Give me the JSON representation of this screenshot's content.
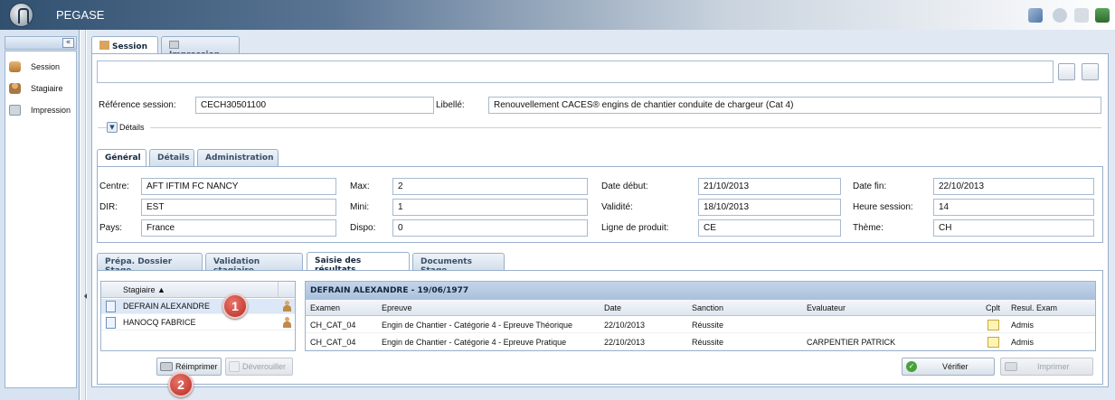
{
  "app": {
    "title": "PEGASE"
  },
  "sidebar": {
    "collapse_label": "«",
    "items": [
      {
        "label": "Session"
      },
      {
        "label": "Stagiaire"
      },
      {
        "label": "Impression"
      }
    ]
  },
  "main_tabs": [
    {
      "label": "Session",
      "active": true
    },
    {
      "label": "Impression",
      "active": false
    }
  ],
  "session": {
    "search_value": "",
    "reference_label": "Référence session:",
    "reference_value": "CECH30501100",
    "libelle_label": "Libellé:",
    "libelle_value": "Renouvellement CACES® engins de chantier conduite de chargeur (Cat 4)",
    "details_toggle": "Détails"
  },
  "detail_tabs": [
    {
      "label": "Général",
      "active": true
    },
    {
      "label": "Détails",
      "active": false
    },
    {
      "label": "Administration",
      "active": false
    }
  ],
  "general": {
    "centre_label": "Centre:",
    "centre_value": "AFT IFTIM FC NANCY",
    "dir_label": "DIR:",
    "dir_value": "EST",
    "pays_label": "Pays:",
    "pays_value": "France",
    "max_label": "Max:",
    "max_value": "2",
    "mini_label": "Mini:",
    "mini_value": "1",
    "dispo_label": "Dispo:",
    "dispo_value": "0",
    "date_debut_label": "Date début:",
    "date_debut_value": "21/10/2013",
    "validite_label": "Validité:",
    "validite_value": "18/10/2013",
    "ligne_label": "Ligne de produit:",
    "ligne_value": "CE",
    "date_fin_label": "Date fin:",
    "date_fin_value": "22/10/2013",
    "heure_label": "Heure session:",
    "heure_value": "14",
    "theme_label": "Thème:",
    "theme_value": "CH"
  },
  "stage_tabs": [
    {
      "label": "Prépa. Dossier Stage",
      "active": false
    },
    {
      "label": "Validation stagiaire",
      "active": false
    },
    {
      "label": "Saisie des résultats",
      "active": true
    },
    {
      "label": "Documents Stage",
      "active": false
    }
  ],
  "stagiaire_grid": {
    "header": "Stagiaire ▲",
    "rows": [
      {
        "name": "DEFRAIN ALEXANDRE"
      },
      {
        "name": "HANOCQ FABRICE"
      }
    ]
  },
  "results": {
    "title": "DEFRAIN ALEXANDRE - 19/06/1977",
    "columns": [
      "Examen",
      "Epreuve",
      "Date",
      "Sanction",
      "Evaluateur",
      "Cplt",
      "Resul. Exam"
    ],
    "rows": [
      {
        "examen": "CH_CAT_04",
        "epreuve": "Engin de Chantier - Catégorie 4 - Epreuve Théorique",
        "date": "22/10/2013",
        "sanction": "Réussite",
        "evaluateur": "",
        "resul": "Admis"
      },
      {
        "examen": "CH_CAT_04",
        "epreuve": "Engin de Chantier - Catégorie 4 - Epreuve Pratique",
        "date": "22/10/2013",
        "sanction": "Réussite",
        "evaluateur": "CARPENTIER PATRICK",
        "resul": "Admis"
      }
    ]
  },
  "buttons": {
    "reimprimer": "Réimprimer",
    "deverrouiller": "Déverouiller",
    "verifier": "Vérifier",
    "imprimer": "Imprimer"
  },
  "callouts": {
    "one": "1",
    "two": "2"
  },
  "colors": {
    "accent": "#31506f",
    "callout": "#c0392b"
  }
}
